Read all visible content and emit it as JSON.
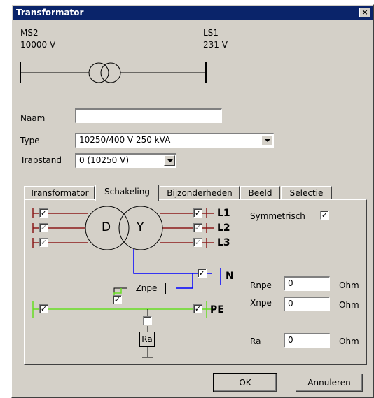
{
  "window": {
    "title": "Transformator",
    "close_label": "×"
  },
  "bus_left": {
    "name": "MS2",
    "voltage": "10000 V"
  },
  "bus_right": {
    "name": "LS1",
    "voltage": "231 V"
  },
  "form": {
    "naam_label": "Naam",
    "naam_value": "",
    "type_label": "Type",
    "type_value": "10250/400 V  250 kVA",
    "trapstand_label": "Trapstand",
    "trapstand_value": "0   (10250 V)"
  },
  "tabs": [
    {
      "label": "Transformator",
      "active": false
    },
    {
      "label": "Schakeling",
      "active": true
    },
    {
      "label": "Bijzonderheden",
      "active": false
    },
    {
      "label": "Beeld",
      "active": false
    },
    {
      "label": "Selectie",
      "active": false
    }
  ],
  "schakeling": {
    "winding_left": "D",
    "winding_right": "Y",
    "phases": [
      "L1",
      "L2",
      "L3"
    ],
    "neutral": "N",
    "pe": "PE",
    "znpe": "Znpe",
    "ra_box": "Ra",
    "check_mark": "✓",
    "symmetrisch_label": "Symmetrisch",
    "symmetrisch_checked": true,
    "rnpe": {
      "label": "Rnpe",
      "value": "0",
      "unit": "Ohm"
    },
    "xnpe": {
      "label": "Xnpe",
      "value": "0",
      "unit": "Ohm"
    },
    "ra": {
      "label": "Ra",
      "value": "0",
      "unit": "Ohm"
    }
  },
  "buttons": {
    "ok": "OK",
    "cancel": "Annuleren"
  },
  "colors": {
    "phase": "#8b1a1a",
    "neutral": "#0000ff",
    "pe": "#66dd22",
    "titlebar": "#0a246a"
  }
}
